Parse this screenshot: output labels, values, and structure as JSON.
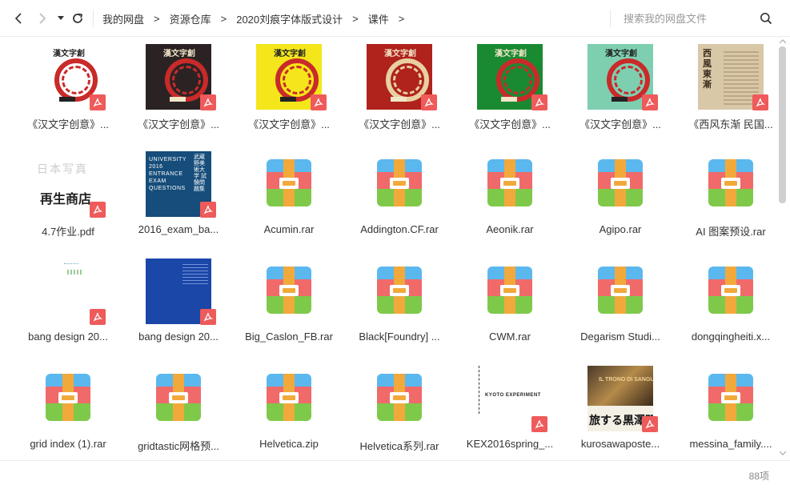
{
  "toolbar": {
    "back_icon": "chevron-left-icon",
    "forward_icon": "chevron-right-icon",
    "history_icon": "caret-down-icon",
    "refresh_icon": "refresh-icon"
  },
  "breadcrumb": {
    "items": [
      "我的网盘",
      "资源仓库",
      "2020刘痕字体版式设计",
      "课件"
    ],
    "separator": ">"
  },
  "search": {
    "placeholder": "搜索我的网盘文件",
    "icon": "search-icon"
  },
  "files": [
    {
      "name": "《汉文字创意》...",
      "type": "pdf",
      "cover": "#ffffff"
    },
    {
      "name": "《汉文字创意》...",
      "type": "pdf",
      "cover": "#2b2323"
    },
    {
      "name": "《汉文字创意》...",
      "type": "pdf",
      "cover": "#f4e61a"
    },
    {
      "name": "《汉文字创意》...",
      "type": "pdf",
      "cover": "#b0221c"
    },
    {
      "name": "《汉文字创意》...",
      "type": "pdf",
      "cover": "#1a8a32"
    },
    {
      "name": "《汉文字创意》...",
      "type": "pdf",
      "cover": "#7ecfb0"
    },
    {
      "name": "《西风东渐  民国...",
      "type": "pdf",
      "cover": "#d8c8a8"
    },
    {
      "name": "4.7作业.pdf",
      "type": "pdf",
      "cover": "#ffffff"
    },
    {
      "name": "2016_exam_ba...",
      "type": "pdf",
      "cover": "#164d7a"
    },
    {
      "name": "Acumin.rar",
      "type": "rar"
    },
    {
      "name": "Addington.CF.rar",
      "type": "rar"
    },
    {
      "name": "Aeonik.rar",
      "type": "rar"
    },
    {
      "name": "Agipo.rar",
      "type": "rar"
    },
    {
      "name": "AI 图案预设.rar",
      "type": "rar"
    },
    {
      "name": "bang design 20...",
      "type": "pdf",
      "cover": "#ffffff"
    },
    {
      "name": "bang design 20...",
      "type": "pdf",
      "cover": "#1a47a8"
    },
    {
      "name": "Big_Caslon_FB.rar",
      "type": "rar"
    },
    {
      "name": "Black[Foundry] ...",
      "type": "rar"
    },
    {
      "name": "CWM.rar",
      "type": "rar"
    },
    {
      "name": "Degarism Studi...",
      "type": "rar"
    },
    {
      "name": "dongqingheiti.x...",
      "type": "rar"
    },
    {
      "name": "grid index (1).rar",
      "type": "rar"
    },
    {
      "name": "gridtastic网格预...",
      "type": "rar"
    },
    {
      "name": "Helvetica.zip",
      "type": "rar"
    },
    {
      "name": "Helvetica系列.rar",
      "type": "rar"
    },
    {
      "name": "KEX2016spring_...",
      "type": "pdf",
      "cover": "#ffffff"
    },
    {
      "name": "kurosawaposte...",
      "type": "pdf",
      "cover": "#8a6a3a"
    },
    {
      "name": "messina_family....",
      "type": "rar"
    }
  ],
  "thumb_texts": {
    "han_title": "漢文字創",
    "xifeng_title": "西風東漸",
    "zuoye_line1": "日本写真",
    "zuoye_line2": "再生商店",
    "exam_en": "UNIVERSITY 2016 ENTRANCE EXAM QUESTIONS",
    "exam_jp": "武蔵野美術大学 試験問題集",
    "kex_title": "KYOTO EXPERIMENT",
    "kurosawa_title": "旅する黒澤明",
    "kurosawa_sub": "IL TRONO DI SANGUE"
  },
  "status": {
    "count": "88项"
  },
  "colors": {
    "pdf_badge": "#ef5a5a",
    "rar_blue": "#5bb8ef",
    "rar_red": "#f06a6a",
    "rar_green": "#7ec94a",
    "rar_strap": "#f2a93b"
  }
}
